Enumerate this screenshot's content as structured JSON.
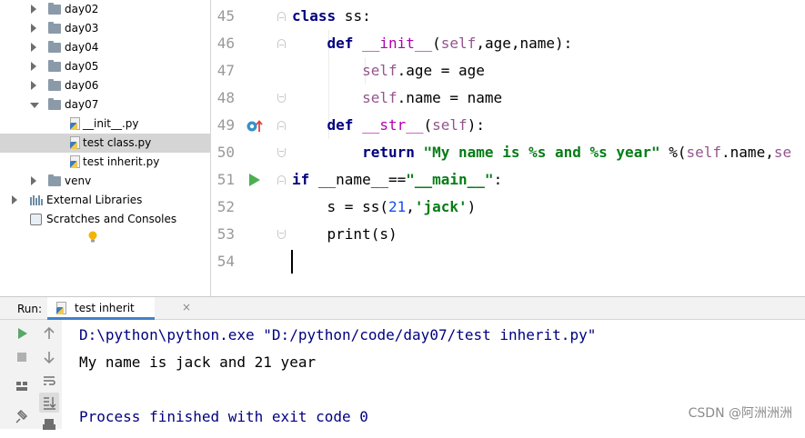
{
  "project_tree": {
    "items": [
      {
        "label": "day02",
        "type": "folder",
        "expanded": false
      },
      {
        "label": "day03",
        "type": "folder",
        "expanded": false
      },
      {
        "label": "day04",
        "type": "folder",
        "expanded": false
      },
      {
        "label": "day05",
        "type": "folder",
        "expanded": false
      },
      {
        "label": "day06",
        "type": "folder",
        "expanded": false
      },
      {
        "label": "day07",
        "type": "folder",
        "expanded": true
      },
      {
        "label": "__init__.py",
        "type": "python-file"
      },
      {
        "label": "test class.py",
        "type": "python-file",
        "selected": true
      },
      {
        "label": "test inherit.py",
        "type": "python-file"
      },
      {
        "label": "venv",
        "type": "folder",
        "expanded": false
      },
      {
        "label": "External Libraries",
        "type": "library"
      },
      {
        "label": "Scratches and Consoles",
        "type": "scratch"
      }
    ]
  },
  "editor": {
    "line_numbers": [
      "45",
      "46",
      "47",
      "48",
      "49",
      "50",
      "51",
      "52",
      "53",
      "54"
    ],
    "lines": [
      {
        "tokens": [
          [
            "kw",
            "class"
          ],
          [
            "plain",
            " ss:"
          ]
        ]
      },
      {
        "tokens": [
          [
            "plain",
            "    "
          ],
          [
            "kw",
            "def"
          ],
          [
            "plain",
            " "
          ],
          [
            "magic",
            "__init__"
          ],
          [
            "plain",
            "("
          ],
          [
            "self",
            "self"
          ],
          [
            "plain",
            ",age,name):"
          ]
        ]
      },
      {
        "tokens": [
          [
            "plain",
            "        "
          ],
          [
            "self",
            "self"
          ],
          [
            "plain",
            ".age = age"
          ]
        ]
      },
      {
        "tokens": [
          [
            "plain",
            "        "
          ],
          [
            "self",
            "self"
          ],
          [
            "plain",
            ".name = name"
          ]
        ]
      },
      {
        "tokens": [
          [
            "plain",
            "    "
          ],
          [
            "kw",
            "def"
          ],
          [
            "plain",
            " "
          ],
          [
            "magic",
            "__str__"
          ],
          [
            "plain",
            "("
          ],
          [
            "self",
            "self"
          ],
          [
            "plain",
            "):"
          ]
        ]
      },
      {
        "tokens": [
          [
            "plain",
            "        "
          ],
          [
            "kw",
            "return"
          ],
          [
            "plain",
            " "
          ],
          [
            "str",
            "\"My name is %s and %s year\""
          ],
          [
            "plain",
            " %("
          ],
          [
            "self",
            "self"
          ],
          [
            "plain",
            ".name,"
          ],
          [
            "self",
            "se"
          ]
        ]
      },
      {
        "tokens": [
          [
            "kw",
            "if"
          ],
          [
            "plain",
            " __name__=="
          ],
          [
            "str",
            "\"__main__\""
          ],
          [
            "plain",
            ":"
          ]
        ]
      },
      {
        "tokens": [
          [
            "plain",
            "    s = ss("
          ],
          [
            "num",
            "21"
          ],
          [
            "plain",
            ","
          ],
          [
            "str",
            "'jack'"
          ],
          [
            "plain",
            ")"
          ]
        ]
      },
      {
        "tokens": [
          [
            "plain",
            "    print(s)"
          ]
        ]
      },
      {
        "tokens": [
          [
            "plain",
            ""
          ]
        ]
      }
    ],
    "icons": {
      "line_49": "override-method-icon",
      "line_51": "run-arrow-icon",
      "line_53": "intention-bulb-icon"
    },
    "colors": {
      "keyword": "#000080",
      "string": "#067d17",
      "self": "#94558d",
      "number": "#1750eb",
      "magic": "#b200b2"
    }
  },
  "run_panel": {
    "label": "Run:",
    "tab_label": "test inherit",
    "tab_close": "×",
    "console": [
      {
        "text": "D:\\python\\python.exe \"D:/python/code/day07/test inherit.py\"",
        "color": "#000080"
      },
      {
        "text": "My name is jack and 21 year",
        "color": "#000000"
      },
      {
        "text": "",
        "color": "#000000"
      },
      {
        "text": "Process finished with exit code 0",
        "color": "#000080"
      }
    ]
  },
  "watermark": "CSDN @阿洲洲洲"
}
